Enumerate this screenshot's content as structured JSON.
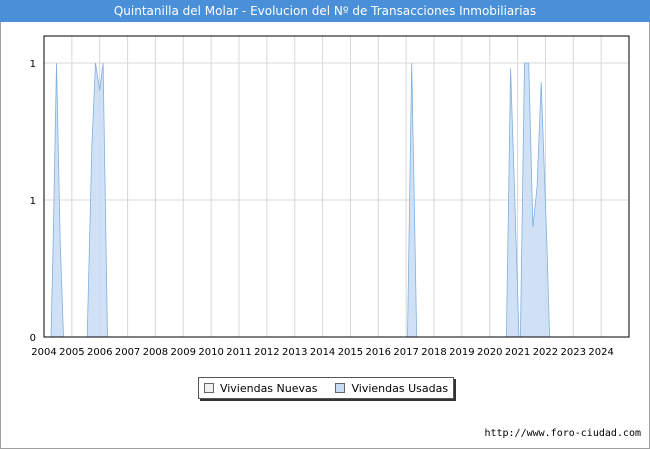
{
  "header": {
    "title": "Quintanilla del Molar - Evolucion del Nº de Transacciones Inmobiliarias"
  },
  "footer": {
    "url": "http://www.foro-ciudad.com"
  },
  "legend": {
    "items": [
      {
        "label": "Viviendas Nuevas",
        "color": "#f0f0f0"
      },
      {
        "label": "Viviendas Usadas",
        "color": "#c8dcf4"
      }
    ]
  },
  "chart_data": {
    "type": "area",
    "xlabel": "",
    "ylabel": "",
    "xlim": [
      2004,
      2025
    ],
    "ylim": [
      0,
      1
    ],
    "y_tick_values": [
      0,
      0.5,
      1
    ],
    "y_tick_labels": [
      "0",
      "1",
      "1"
    ],
    "x_ticks": [
      "2004",
      "2005",
      "2006",
      "2007",
      "2008",
      "2009",
      "2010",
      "2011",
      "2012",
      "2013",
      "2014",
      "2015",
      "2016",
      "2017",
      "2018",
      "2019",
      "2020",
      "2021",
      "2022",
      "2023",
      "2024"
    ],
    "grid": true,
    "legend_position": "bottom-center",
    "series": [
      {
        "name": "Viviendas Nuevas",
        "color": "#f0f0f0",
        "points": []
      },
      {
        "name": "Viviendas Usadas",
        "color": "#c8dcf4",
        "points": [
          [
            2004.25,
            0
          ],
          [
            2004.33,
            0.35
          ],
          [
            2004.45,
            1
          ],
          [
            2004.58,
            0.35
          ],
          [
            2004.7,
            0
          ],
          [
            2005.55,
            0
          ],
          [
            2005.72,
            0.7
          ],
          [
            2005.85,
            1
          ],
          [
            2006.0,
            0.9
          ],
          [
            2006.12,
            1
          ],
          [
            2006.28,
            0
          ],
          [
            2017.05,
            0
          ],
          [
            2017.2,
            1
          ],
          [
            2017.38,
            0
          ],
          [
            2020.6,
            0
          ],
          [
            2020.75,
            0.98
          ],
          [
            2020.9,
            0.5
          ],
          [
            2021.05,
            0
          ],
          [
            2021.1,
            0
          ],
          [
            2021.25,
            1
          ],
          [
            2021.4,
            1
          ],
          [
            2021.55,
            0.4
          ],
          [
            2021.7,
            0.55
          ],
          [
            2021.85,
            0.93
          ],
          [
            2022.05,
            0.35
          ],
          [
            2022.15,
            0
          ]
        ]
      }
    ]
  }
}
